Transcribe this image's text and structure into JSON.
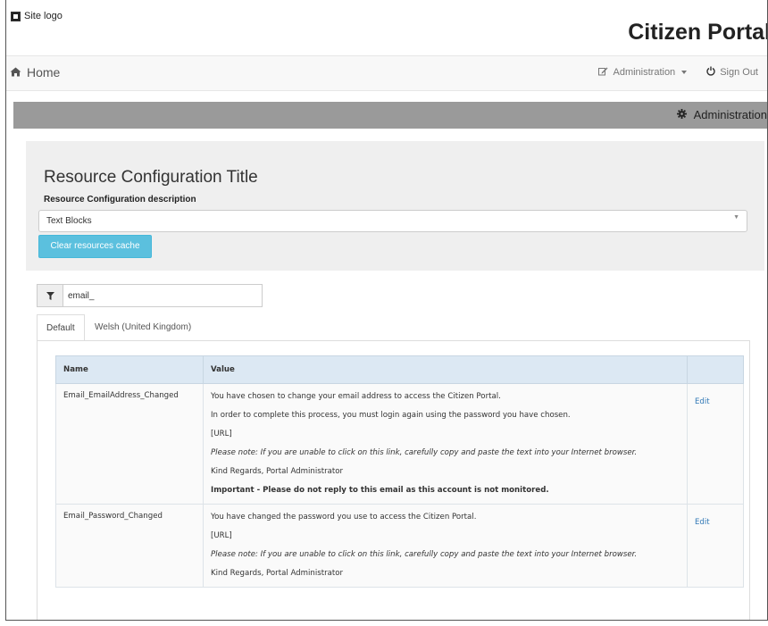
{
  "header": {
    "logo_label": "Site logo",
    "portal_title": "Citizen Portal"
  },
  "navbar": {
    "home_label": "Home",
    "admin_label": "Administration",
    "signout_label": "Sign Out"
  },
  "admin_bar": {
    "label": "Administration"
  },
  "config": {
    "title": "Resource Configuration Title",
    "description": "Resource Configuration description",
    "selected_resource": "Text Blocks",
    "clear_button": "Clear resources cache"
  },
  "filter": {
    "value": "email_"
  },
  "tabs": [
    {
      "label": "Default",
      "active": true
    },
    {
      "label": "Welsh (United Kingdom)",
      "active": false
    }
  ],
  "table": {
    "headers": [
      "Name",
      "Value",
      ""
    ],
    "rows": [
      {
        "name": "Email_EmailAddress_Changed",
        "lines": [
          "You have chosen to change your email address to access the Citizen Portal.",
          "In order to complete this process, you must login again using the password you have chosen.",
          "[URL]",
          "Please note: If you are unable to click on this link, carefully copy and paste the text into your Internet browser.",
          "Kind Regards, Portal Administrator",
          "Important - Please do not reply to this email as this account is not monitored."
        ],
        "action": "Edit"
      },
      {
        "name": "Email_Password_Changed",
        "lines": [
          "You have changed the password you use to access the Citizen Portal.",
          "[URL]",
          "Please note: If you are unable to click on this link, carefully copy and paste the text into your Internet browser.",
          "Kind Regards, Portal Administrator"
        ],
        "action": "Edit"
      }
    ]
  },
  "colors": {
    "admin_bar": "#9a9a9a",
    "button_info": "#5bc0de",
    "table_header": "#dce8f3",
    "link": "#337ab7"
  }
}
